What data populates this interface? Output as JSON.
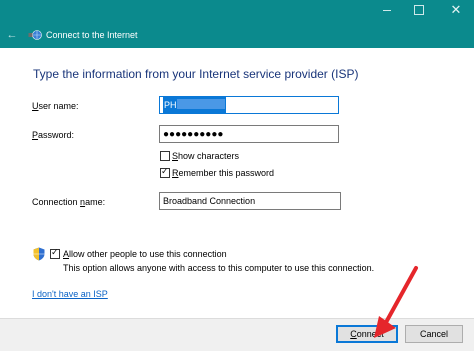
{
  "window": {
    "title": "Connect to the Internet",
    "back_icon": "back-arrow-icon",
    "network_icon": "network-globe-icon",
    "minimize_icon": "minimize-icon",
    "maximize_icon": "maximize-icon",
    "close_icon": "close-icon",
    "title_bar_color": "#0b8a8d"
  },
  "form": {
    "heading": "Type the information from your Internet service provider (ISP)",
    "username_label_u": "U",
    "username_label_rest": "ser name:",
    "username_value": "PH",
    "password_label_u": "P",
    "password_label_rest": "assword:",
    "password_value": "●●●●●●●●●●",
    "show_characters_u": "S",
    "show_characters_rest": "how characters",
    "show_characters_checked": false,
    "remember_u": "R",
    "remember_rest": "emember this password",
    "remember_checked": true,
    "connection_name_label_pre": "Connection ",
    "connection_name_label_u": "n",
    "connection_name_label_rest": "ame:",
    "connection_name_value": "Broadband Connection",
    "allow_others_u": "A",
    "allow_others_rest": "llow other people to use this connection",
    "allow_others_checked": true,
    "allow_others_hint": "This option allows anyone with access to this computer to use this connection.",
    "no_isp_link_pre": "I ",
    "no_isp_link_u": "d",
    "no_isp_link_rest": "on't have an ISP"
  },
  "footer": {
    "connect_u": "C",
    "connect_rest": "onnect",
    "cancel_label": "Cancel"
  },
  "colors": {
    "accent": "#0a78d7",
    "heading": "#19357a",
    "link": "#0b63c6",
    "annotation_arrow": "#e5262b"
  }
}
